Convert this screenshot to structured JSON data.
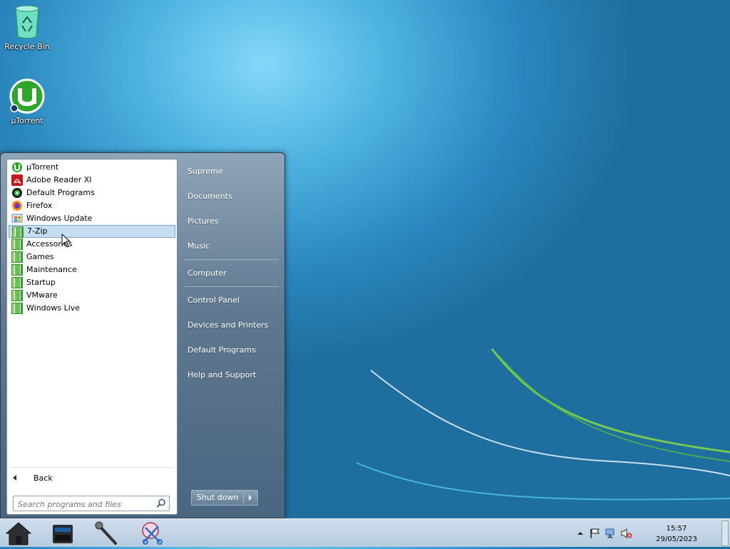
{
  "desktop": {
    "icons": [
      {
        "label": "Recycle Bin"
      },
      {
        "label": "µTorrent"
      }
    ]
  },
  "start_menu": {
    "programs": [
      {
        "label": "µTorrent",
        "icon": "utorrent-icon"
      },
      {
        "label": "Adobe Reader XI",
        "icon": "adobe-reader-icon"
      },
      {
        "label": "Default Programs",
        "icon": "default-programs-icon"
      },
      {
        "label": "Firefox",
        "icon": "firefox-icon"
      },
      {
        "label": "Windows Update",
        "icon": "windows-update-icon"
      },
      {
        "label": "7-Zip",
        "icon": "folder-icon",
        "selected": true
      },
      {
        "label": "Accessories",
        "icon": "folder-icon"
      },
      {
        "label": "Games",
        "icon": "folder-icon"
      },
      {
        "label": "Maintenance",
        "icon": "folder-icon"
      },
      {
        "label": "Startup",
        "icon": "folder-icon"
      },
      {
        "label": "VMware",
        "icon": "folder-icon"
      },
      {
        "label": "Windows Live",
        "icon": "folder-icon"
      }
    ],
    "back_label": "Back",
    "search_placeholder": "Search programs and files",
    "right_links": {
      "user": "Supreme",
      "documents": "Documents",
      "pictures": "Pictures",
      "music": "Music",
      "computer": "Computer",
      "control_panel": "Control Panel",
      "devices_printers": "Devices and Printers",
      "default_programs": "Default Programs",
      "help_support": "Help and Support"
    },
    "shutdown_label": "Shut down"
  },
  "taskbar": {
    "pinned": [
      "home-icon",
      "scanner-icon",
      "microphone-icon",
      "scissors-icon"
    ],
    "clock_time": "15:57",
    "clock_date": "29/05/2023"
  },
  "colors": {
    "selection": "#c7ddf2",
    "wallpaper": "#2a86bd"
  }
}
